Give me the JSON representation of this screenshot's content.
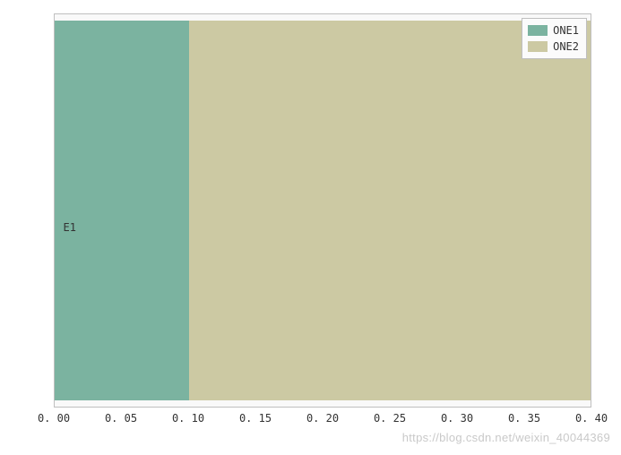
{
  "chart_data": {
    "type": "bar",
    "orientation": "horizontal",
    "stacked": true,
    "categories": [
      "E1"
    ],
    "series": [
      {
        "name": "ONE1",
        "values": [
          0.1
        ],
        "color": "#7bb3a0"
      },
      {
        "name": "ONE2",
        "values": [
          0.3
        ],
        "color": "#ccc9a3"
      }
    ],
    "xlim": [
      0.0,
      0.4
    ],
    "x_ticks": [
      0.0,
      0.05,
      0.1,
      0.15,
      0.2,
      0.25,
      0.3,
      0.35,
      0.4
    ],
    "x_tick_labels": [
      "0. 00",
      "0. 05",
      "0. 10",
      "0. 15",
      "0. 20",
      "0. 25",
      "0. 30",
      "0. 35",
      "0. 40"
    ],
    "legend_position": "upper-right",
    "grid": false
  },
  "legend": {
    "items": [
      {
        "label": "ONE1",
        "color": "#7bb3a0"
      },
      {
        "label": "ONE2",
        "color": "#ccc9a3"
      }
    ]
  },
  "y_category_label": "E1",
  "watermark": "https://blog.csdn.net/weixin_40044369"
}
